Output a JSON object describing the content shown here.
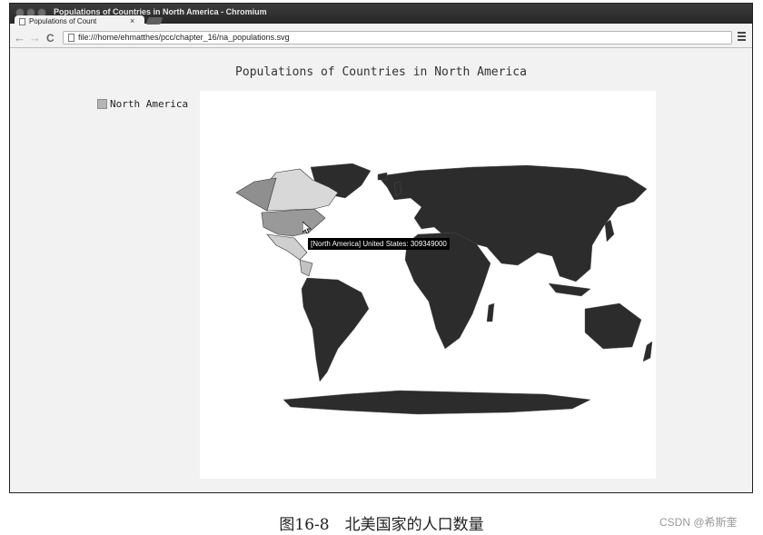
{
  "window": {
    "title": "Populations of Countries in North America - Chromium",
    "tab_label": "Populations of Count",
    "tab_close": "×"
  },
  "toolbar": {
    "url": "file:///home/ehmatthes/pcc/chapter_16/na_populations.svg",
    "back_glyph": "←",
    "forward_glyph": "→",
    "reload_glyph": "C"
  },
  "chart": {
    "title": "Populations of Countries in North America",
    "legend": [
      {
        "label": "North America",
        "color": "#b5b5b5"
      }
    ],
    "tooltip": "[North America] United States: 309349000"
  },
  "chart_data": {
    "type": "map",
    "title": "Populations of Countries in North America",
    "series": [
      {
        "name": "North America",
        "values": [
          {
            "label": "United States",
            "value": 309349000
          }
        ]
      }
    ],
    "colors": {
      "highlighted_countries": "#b5b5b5",
      "other_countries": "#2c2c2c",
      "background": "#ffffff"
    }
  },
  "caption": "图16-8　北美国家的人口数量",
  "credit": "CSDN @希斯奎"
}
